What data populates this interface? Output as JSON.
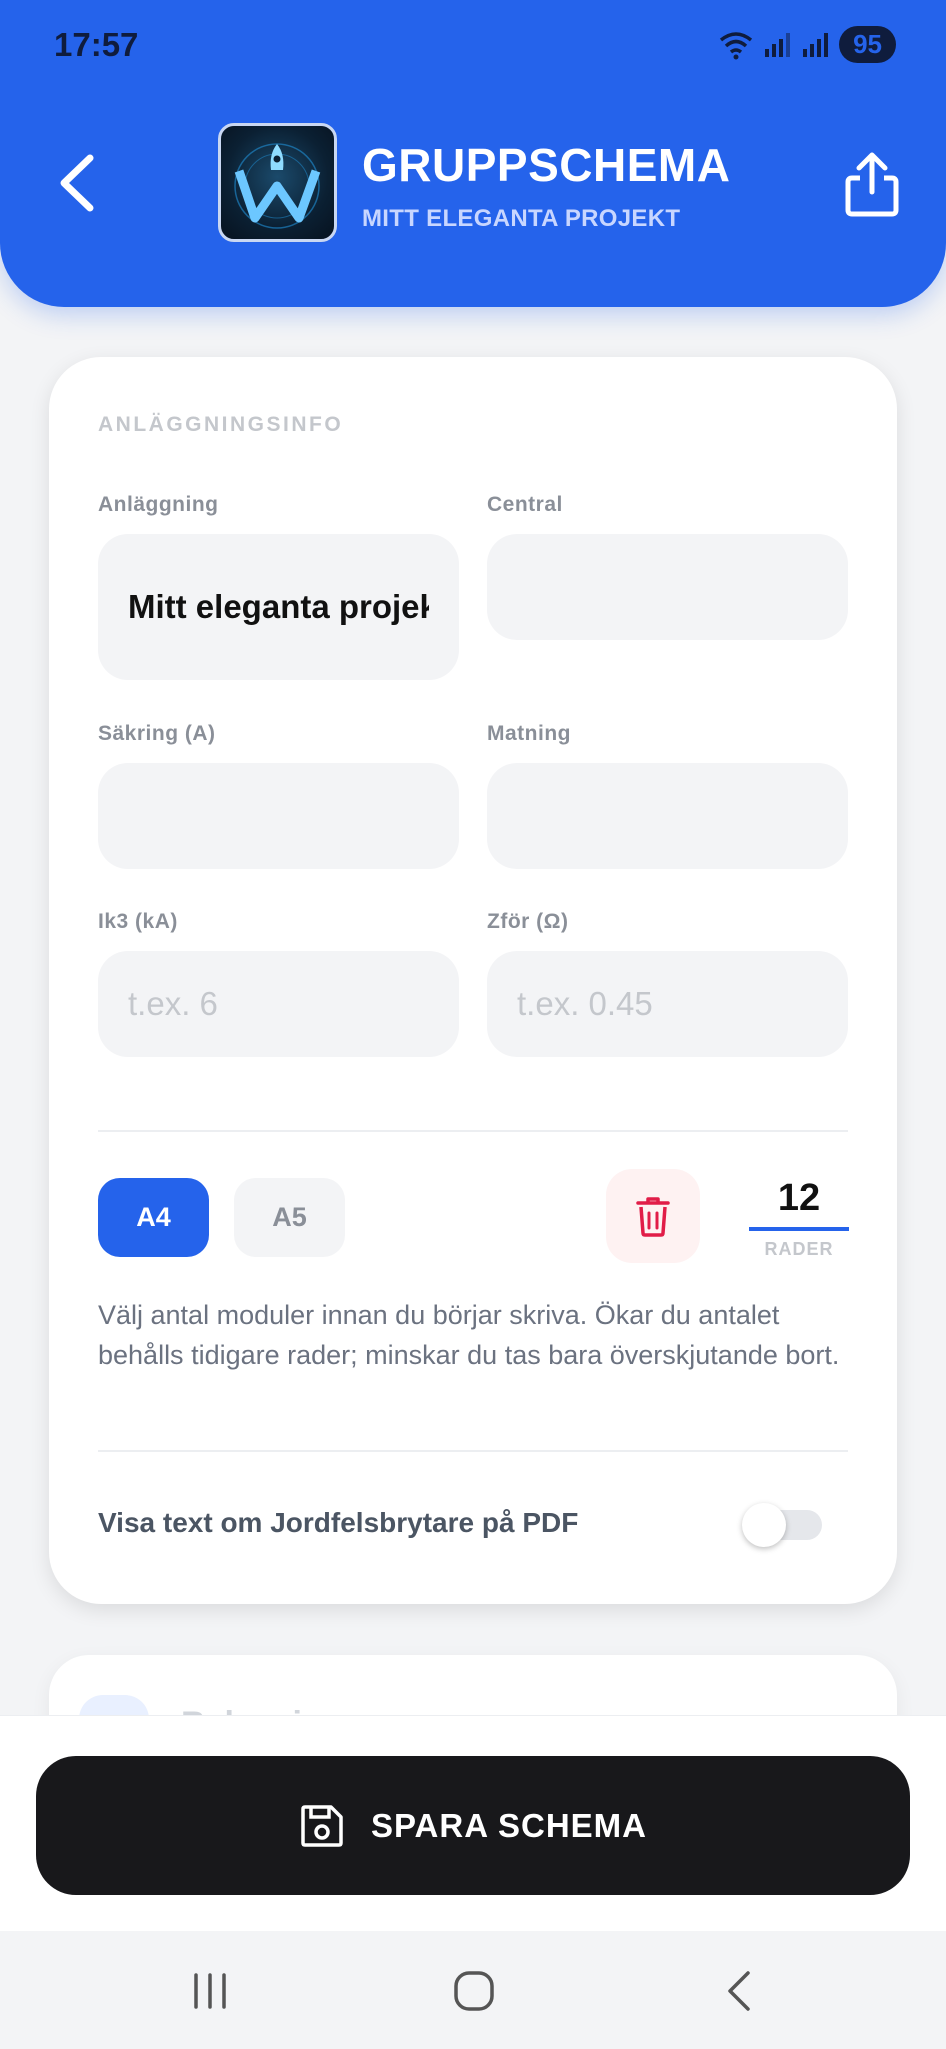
{
  "status_bar": {
    "time": "17:57",
    "battery": "95"
  },
  "header": {
    "title": "GRUPPSCHEMA",
    "subtitle": "MITT ELEGANTA PROJEKT"
  },
  "colors": {
    "accent": "#2563eb",
    "danger": "#e11d48",
    "dark": "#18181b"
  },
  "facility": {
    "section_title": "ANLÄGGNINGSINFO",
    "anlaggning": {
      "label": "Anläggning",
      "value": "Mitt eleganta projekt",
      "placeholder": ""
    },
    "central": {
      "label": "Central",
      "value": "",
      "placeholder": ""
    },
    "sakring": {
      "label": "Säkring (A)",
      "value": "",
      "placeholder": ""
    },
    "matning": {
      "label": "Matning",
      "value": "",
      "placeholder": ""
    },
    "ik3": {
      "label": "Ik3 (kA)",
      "value": "",
      "placeholder": "t.ex. 6"
    },
    "zfor": {
      "label": "Zför (Ω)",
      "value": "",
      "placeholder": "t.ex. 0.45"
    }
  },
  "format": {
    "a4": "A4",
    "a5": "A5",
    "selected": "A4"
  },
  "rows": {
    "value": "12",
    "label": "RADER"
  },
  "help_text": "Välj antal moduler innan du börjar skriva. Ökar du antalet behålls tidigare rader; minskar du tas bara överskjutande bort.",
  "toggle": {
    "label": "Visa text om Jordfelsbrytare på PDF",
    "on": false
  },
  "peek_row": {
    "number": "1",
    "title": "Belysning"
  },
  "actions": {
    "save": "SPARA SCHEMA"
  }
}
